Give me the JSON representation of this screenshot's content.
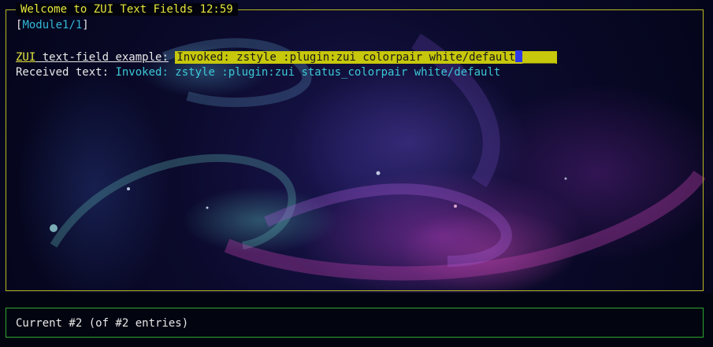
{
  "window": {
    "title": "Welcome to ZUI Text Fields 12:59"
  },
  "module_line": {
    "open_bracket": "[",
    "link_label": "Module1/1",
    "close_bracket": "]"
  },
  "text_field": {
    "label_prefix": "ZUI",
    "label_rest": " text-field example:",
    "value": "Invoked: zstyle :plugin:zui colorpair white/default",
    "fill": "_____"
  },
  "received": {
    "label": "Received text: ",
    "value": "Invoked: zstyle :plugin:zui status_colorpair white/default"
  },
  "status": {
    "text": "Current #2 (of #2 entries)"
  },
  "colors": {
    "frame_border": "#b8b81e",
    "title_text": "#e7e73c",
    "link": "#32b8d6",
    "input_background": "#c7c70c",
    "cursor": "#2d39e8",
    "received_value": "#3cc8d6",
    "status_border": "#2ea82e"
  },
  "icons": {
    "cursor": "block-cursor"
  }
}
